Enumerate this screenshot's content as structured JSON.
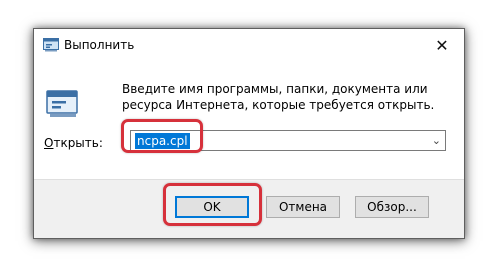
{
  "window": {
    "title": "Выполнить",
    "close_glyph": "✕"
  },
  "description": "Введите имя программы, папки, документа или ресурса Интернета, которые требуется открыть.",
  "open_field": {
    "label_prefix": "О",
    "label_rest": "ткрыть:",
    "value": "ncpa.cpl",
    "dropdown_glyph": "⌄"
  },
  "buttons": {
    "ok": "OK",
    "cancel": "Отмена",
    "browse": "Обзор..."
  },
  "colors": {
    "highlight": "#d6313b",
    "selection": "#0078d7",
    "footer": "#f0f0f0"
  },
  "icons": [
    "run-icon",
    "close-icon",
    "chevron-down-icon"
  ]
}
